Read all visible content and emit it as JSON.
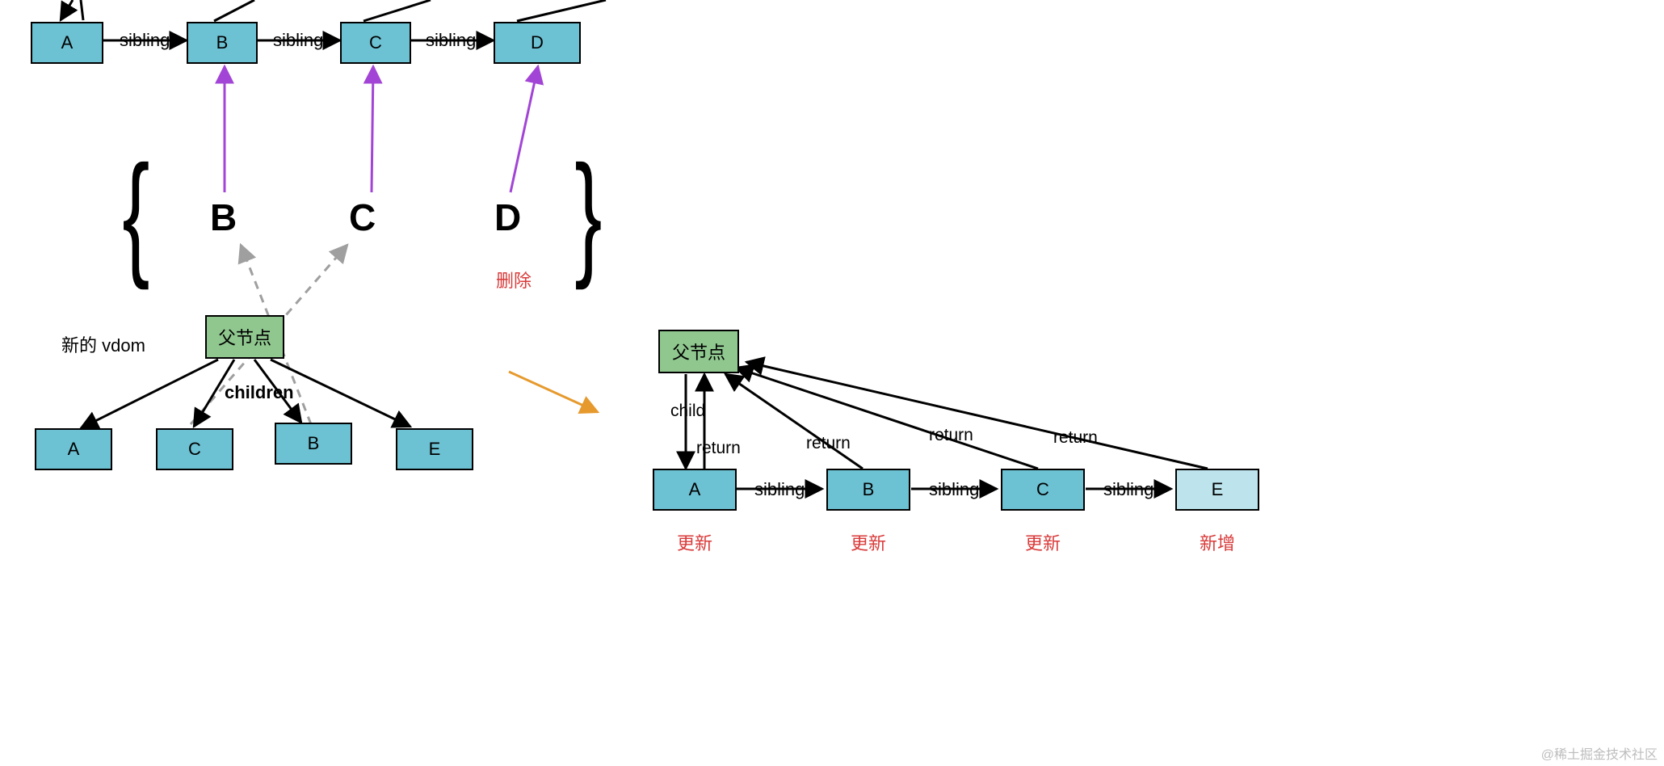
{
  "topRow": {
    "nodes": [
      "A",
      "B",
      "C",
      "D"
    ],
    "edgeLabel": "sibling"
  },
  "mapSet": {
    "items": [
      "B",
      "C",
      "D"
    ],
    "deleteLabel": "删除"
  },
  "newVdom": {
    "caption": "新的 vdom",
    "parentLabel": "父节点",
    "childrenLabel": "children",
    "children": [
      "A",
      "C",
      "B",
      "E"
    ]
  },
  "result": {
    "parentLabel": "父节点",
    "childLabel": "child",
    "returnLabel": "return",
    "siblingLabel": "sibling",
    "leaves": [
      {
        "name": "A",
        "tag": "更新",
        "light": false
      },
      {
        "name": "B",
        "tag": "更新",
        "light": false
      },
      {
        "name": "C",
        "tag": "更新",
        "light": false
      },
      {
        "name": "E",
        "tag": "新增",
        "light": true
      }
    ]
  },
  "watermark": "@稀土掘金技术社区"
}
